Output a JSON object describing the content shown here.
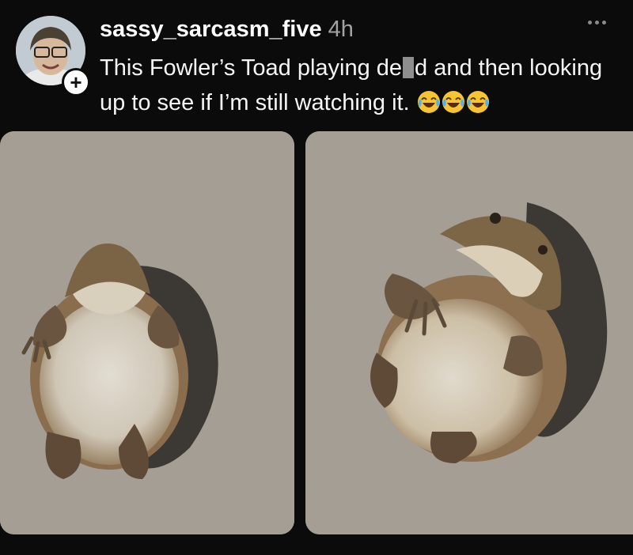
{
  "post": {
    "username": "sassy_sarcasm_five",
    "timestamp": "4h",
    "caption_part1": "This Fowler’s Toad playing de",
    "caption_part2": "d and then looking up to see if I’m still watching it.",
    "emoji_icons": [
      "face-with-tears-of-joy-icon",
      "face-with-tears-of-joy-icon",
      "face-with-tears-of-joy-icon"
    ],
    "follow_symbol": "+",
    "images": [
      {
        "name": "toad-photo-playing-dead"
      },
      {
        "name": "toad-photo-looking-up"
      }
    ]
  },
  "colors": {
    "background": "#0b0b0b",
    "username": "#ffffff",
    "timestamp": "#a2a2a2",
    "caption": "#f5f5f5",
    "concrete": "#a49e94"
  }
}
